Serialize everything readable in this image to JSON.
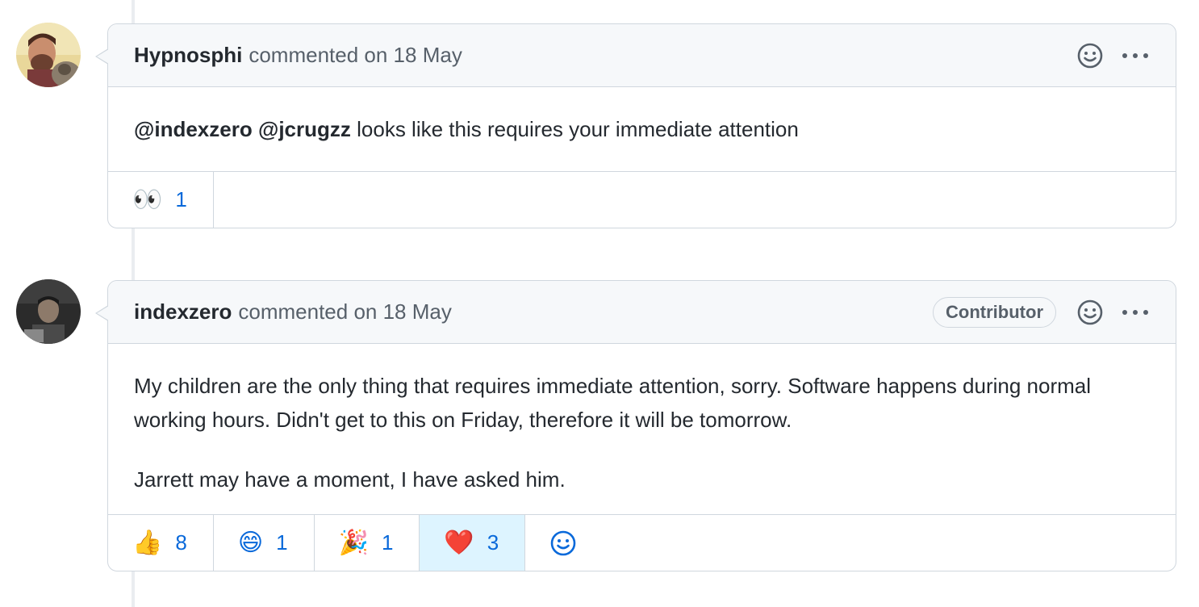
{
  "comments": [
    {
      "author": "Hypnosphi",
      "meta": "commented on 18 May",
      "badge": "",
      "mentions": [
        "@indexzero",
        "@jcrugzz"
      ],
      "body": "looks like this requires your immediate attention",
      "reactions": [
        {
          "emoji": "👀",
          "icon": "eyes-emoji",
          "count": "1",
          "active": false
        }
      ]
    },
    {
      "author": "indexzero",
      "meta": "commented on 18 May",
      "badge": "Contributor",
      "paragraphs": [
        "My children are the only thing that requires immediate attention, sorry. Software happens during normal working hours. Didn't get to this on Friday, therefore it will be tomorrow.",
        "Jarrett may have a moment, I have asked him."
      ],
      "reactions": [
        {
          "emoji": "👍",
          "icon": "thumbs-up-emoji",
          "count": "8",
          "active": false
        },
        {
          "emoji": "😄",
          "icon": "laugh-emoji",
          "count": "1",
          "active": false
        },
        {
          "emoji": "🎉",
          "icon": "hooray-emoji",
          "count": "1",
          "active": false
        },
        {
          "emoji": "❤️",
          "icon": "heart-emoji",
          "count": "3",
          "active": true
        }
      ]
    }
  ],
  "colors": {
    "link": "#0969da",
    "border": "#d0d7de",
    "header_bg": "#f6f8fa",
    "active_reaction_bg": "#ddf4ff"
  },
  "icons": {
    "header": [
      "smiley-icon",
      "kebab-menu-icon"
    ],
    "add_reaction": "smiley-icon"
  }
}
